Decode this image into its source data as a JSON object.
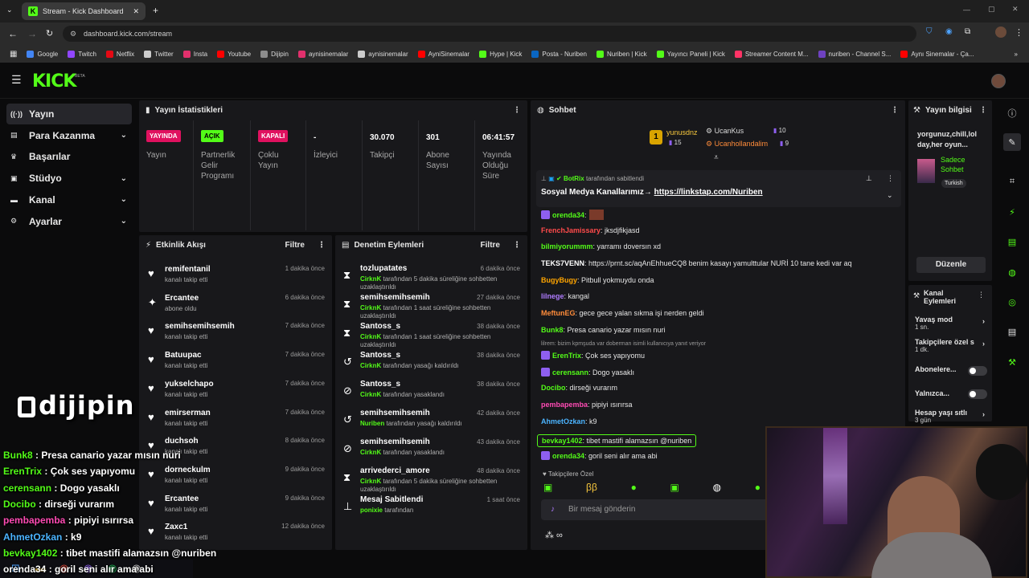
{
  "browser": {
    "tab_title": "Stream - Kick Dashboard",
    "url": "dashboard.kick.com/stream",
    "bookmarks": [
      "Google",
      "Twitch",
      "Netflix",
      "Twitter",
      "Insta",
      "Youtube",
      "Dijipin",
      "aynisinemalar",
      "aynisinemalar",
      "AyniSinemalar",
      "Hype | Kick",
      "Posta - Nuriben",
      "Nuriben | Kick",
      "Yayıncı Paneli | Kick",
      "Streamer Content M...",
      "nuriben - Channel S...",
      "Aynı Sinemalar - Ça..."
    ],
    "bookmark_colors": [
      "#4285f4",
      "#9146ff",
      "#e50914",
      "#cccccc",
      "#e1306c",
      "#ff0000",
      "#8c8c8c",
      "#e1306c",
      "#cccccc",
      "#ff0000",
      "#53fc18",
      "#0a66c2",
      "#53fc18",
      "#53fc18",
      "#ff3366",
      "#6f42c1",
      "#ff0000"
    ]
  },
  "kick": {
    "logo": "KICK",
    "beta": "BETA"
  },
  "nav": [
    {
      "label": "Yayın",
      "icon": "broadcast-icon",
      "chev": ""
    },
    {
      "label": "Para Kazanma",
      "icon": "money-icon",
      "chev": "⌄"
    },
    {
      "label": "Başarılar",
      "icon": "trophy-icon",
      "chev": ""
    },
    {
      "label": "Stüdyo",
      "icon": "studio-icon",
      "chev": "⌄"
    },
    {
      "label": "Kanal",
      "icon": "channel-icon",
      "chev": "⌄"
    },
    {
      "label": "Ayarlar",
      "icon": "gear-icon",
      "chev": "⌄"
    }
  ],
  "stats": {
    "title": "Yayın İstatistikleri",
    "items": [
      {
        "badge": "YAYINDA",
        "badge_color": "#e0115f",
        "label": "Yayın"
      },
      {
        "badge": "AÇIK",
        "badge_color": "#53fc18",
        "label": "Partnerlik Gelir Programı"
      },
      {
        "badge": "KAPALI",
        "badge_color": "#e0115f",
        "label": "Çoklu Yayın"
      },
      {
        "value": "-",
        "label": "İzleyici"
      },
      {
        "value": "30.070",
        "label": "Takipçi"
      },
      {
        "value": "301",
        "label": "Abone Sayısı"
      },
      {
        "value": "06:41:57",
        "label": "Yayında Olduğu Süre"
      }
    ]
  },
  "activity": {
    "title": "Etkinlik Akışı",
    "filter": "Filtre",
    "items": [
      {
        "name": "remifentanil",
        "sub": "kanalı takip etti",
        "time": "1 dakika önce",
        "icon": "♥"
      },
      {
        "name": "Ercantee",
        "sub": "abone oldu",
        "time": "6 dakika önce",
        "icon": "✦"
      },
      {
        "name": "semihsemihsemih",
        "sub": "kanalı takip etti",
        "time": "7 dakika önce",
        "icon": "♥"
      },
      {
        "name": "Batuupac",
        "sub": "kanalı takip etti",
        "time": "7 dakika önce",
        "icon": "♥"
      },
      {
        "name": "yukselchapo",
        "sub": "kanalı takip etti",
        "time": "7 dakika önce",
        "icon": "♥"
      },
      {
        "name": "emirserman",
        "sub": "kanalı takip etti",
        "time": "7 dakika önce",
        "icon": "♥"
      },
      {
        "name": "duchsoh",
        "sub": "kanalı takip etti",
        "time": "8 dakika önce",
        "icon": "♥"
      },
      {
        "name": "dorneckulm",
        "sub": "kanalı takip etti",
        "time": "9 dakika önce",
        "icon": "♥"
      },
      {
        "name": "Ercantee",
        "sub": "kanalı takip etti",
        "time": "9 dakika önce",
        "icon": "♥"
      },
      {
        "name": "Zaxc1",
        "sub": "kanalı takip etti",
        "time": "12 dakika önce",
        "icon": "♥"
      }
    ]
  },
  "moderation": {
    "title": "Denetim Eylemleri",
    "filter": "Filtre",
    "items": [
      {
        "name": "tozlupatates",
        "actor": "CirknK",
        "sub": "tarafından 5 dakika süreliğine sohbetten uzaklaştırıldı",
        "time": "6 dakika önce",
        "icon": "⧗"
      },
      {
        "name": "semihsemihsemih",
        "actor": "CirknK",
        "sub": "tarafından 1 saat süreliğine sohbetten uzaklaştırıldı",
        "time": "27 dakika önce",
        "icon": "⧗"
      },
      {
        "name": "Santoss_s",
        "actor": "CirknK",
        "sub": "tarafından 1 saat süreliğine sohbetten uzaklaştırıldı",
        "time": "38 dakika önce",
        "icon": "⧗"
      },
      {
        "name": "Santoss_s",
        "actor": "CirknK",
        "sub": "tarafından yasağı kaldırıldı",
        "time": "38 dakika önce",
        "icon": "↺"
      },
      {
        "name": "Santoss_s",
        "actor": "CirknK",
        "sub": "tarafından yasaklandı",
        "time": "38 dakika önce",
        "icon": "⊘"
      },
      {
        "name": "semihsemihsemih",
        "actor": "Nuriben",
        "sub": "tarafından yasağı kaldırıldı",
        "time": "42 dakika önce",
        "icon": "↺"
      },
      {
        "name": "semihsemihsemih",
        "actor": "CirknK",
        "sub": "tarafından yasaklandı",
        "time": "43 dakika önce",
        "icon": "⊘"
      },
      {
        "name": "arrivederci_amore",
        "actor": "CirknK",
        "sub": "tarafından 5 dakika süreliğine sohbetten uzaklaştırıldı",
        "time": "48 dakika önce",
        "icon": "⧗"
      },
      {
        "name": "Mesaj Sabitlendi",
        "actor": "ponixie",
        "sub": "tarafından",
        "time": "1 saat önce",
        "icon": "⊥"
      }
    ]
  },
  "chat": {
    "title": "Sohbet",
    "leaders": [
      {
        "name": "yunusdnz",
        "count": "15",
        "rank": "1"
      },
      {
        "name": "UcanKus",
        "count": "10"
      },
      {
        "name": "Ucanhollandalim",
        "count": "9"
      }
    ],
    "pinned": {
      "user": "BotRix",
      "by": "tarafından sabitlendi",
      "text": "Sosyal Medya Kanallarımız→",
      "link": "https://linkstap.com/Nuriben"
    },
    "messages": [
      {
        "user": "orenda34",
        "color": "#53fc18",
        "text": ":",
        "badge": true
      },
      {
        "user": "FrenchJamissary",
        "color": "#ff4b4b",
        "text": ": jksdjfikjasd"
      },
      {
        "user": "bilmiyorummm",
        "color": "#53fc18",
        "text": ": yarramı doversın xd"
      },
      {
        "user": "TEKS7VENN",
        "color": "#ffffff",
        "text": ": https://prnt.sc/aqAnEhhueCQ8 benim kasayı yamulttular NURİ 10 tane kedi var aq"
      },
      {
        "user": "BugyBugy",
        "color": "#ffa500",
        "text": ": Pitbull yokmuydu onda"
      },
      {
        "user": "lilnege",
        "color": "#b07cff",
        "text": ": kangal"
      },
      {
        "user": "MeftunEG",
        "color": "#ff8c3a",
        "text": ": gece gece yalan sıkma işi nerden geldi"
      },
      {
        "user": "Bunk8",
        "color": "#53fc18",
        "text": ": Presa canario yazar mısın nuri"
      },
      {
        "user": "ErenTrix",
        "color": "#53fc18",
        "text": ": Çok ses yapıyomu",
        "badge": true,
        "reply": "lilrem: bizim kpmşuda var doberman isimli kullanıcıya yanıt veriyor"
      },
      {
        "user": "cerensann",
        "color": "#53fc18",
        "text": ": Dogo yasaklı",
        "badge": true
      },
      {
        "user": "Docibo",
        "color": "#53fc18",
        "text": ": dirseği vurarım"
      },
      {
        "user": "pembapemba",
        "color": "#ff4bb4",
        "text": ": pipiyi ısırırsa"
      },
      {
        "user": "AhmetOzkan",
        "color": "#4bb4ff",
        "text": ": k9"
      },
      {
        "user": "bevkay1402",
        "color": "#53fc18",
        "text": ": tibet mastifi alamazsın @nuriben"
      },
      {
        "user": "orenda34",
        "color": "#53fc18",
        "text": ": goril seni alır ama abi",
        "badge": true
      }
    ],
    "followers_only": "Takipçilere Özel",
    "input_placeholder": "Bir mesaj gönderin"
  },
  "info": {
    "title": "Yayın bilgisi",
    "stream_title": "yorgunuz,chill,lol day,her oyun...",
    "category": "Sadece Sohbet",
    "language": "Turkish",
    "edit": "Düzenle"
  },
  "channel_actions": {
    "title": "Kanal Eylemleri",
    "items": [
      {
        "label": "Yavaş mod",
        "sub": "1 sn."
      },
      {
        "label": "Takipçilere özel s",
        "sub": "1 dk."
      },
      {
        "label": "Abonelere..."
      },
      {
        "label": "Yalnızca..."
      },
      {
        "label": "Hesap yaşı sıtlı",
        "sub": "3 gün"
      }
    ]
  },
  "overlay": {
    "brand": "dijipin",
    "lines": [
      {
        "user": "Bunk8",
        "text": " : Presa canario yazar mısın nuri",
        "color": "#53fc18"
      },
      {
        "user": "ErenTrix",
        "text": " : Çok ses yapıyomu",
        "color": "#53fc18"
      },
      {
        "user": "cerensann",
        "text": " : Dogo yasaklı",
        "color": "#53fc18"
      },
      {
        "user": "Docibo",
        "text": " : dirseği vurarım",
        "color": "#53fc18"
      },
      {
        "user": "pembapemba",
        "text": " : pipiyi ısırırsa",
        "color": "#ff4bb4"
      },
      {
        "user": "AhmetOzkan",
        "text": " : k9",
        "color": "#4bb4ff"
      },
      {
        "user": "bevkay1402",
        "text": " : tibet mastifi alamazsın @nuriben",
        "color": "#53fc18"
      },
      {
        "user": "orenda34",
        "text": " : goril seni alır ama abi",
        "color": "#ffffff"
      }
    ]
  }
}
